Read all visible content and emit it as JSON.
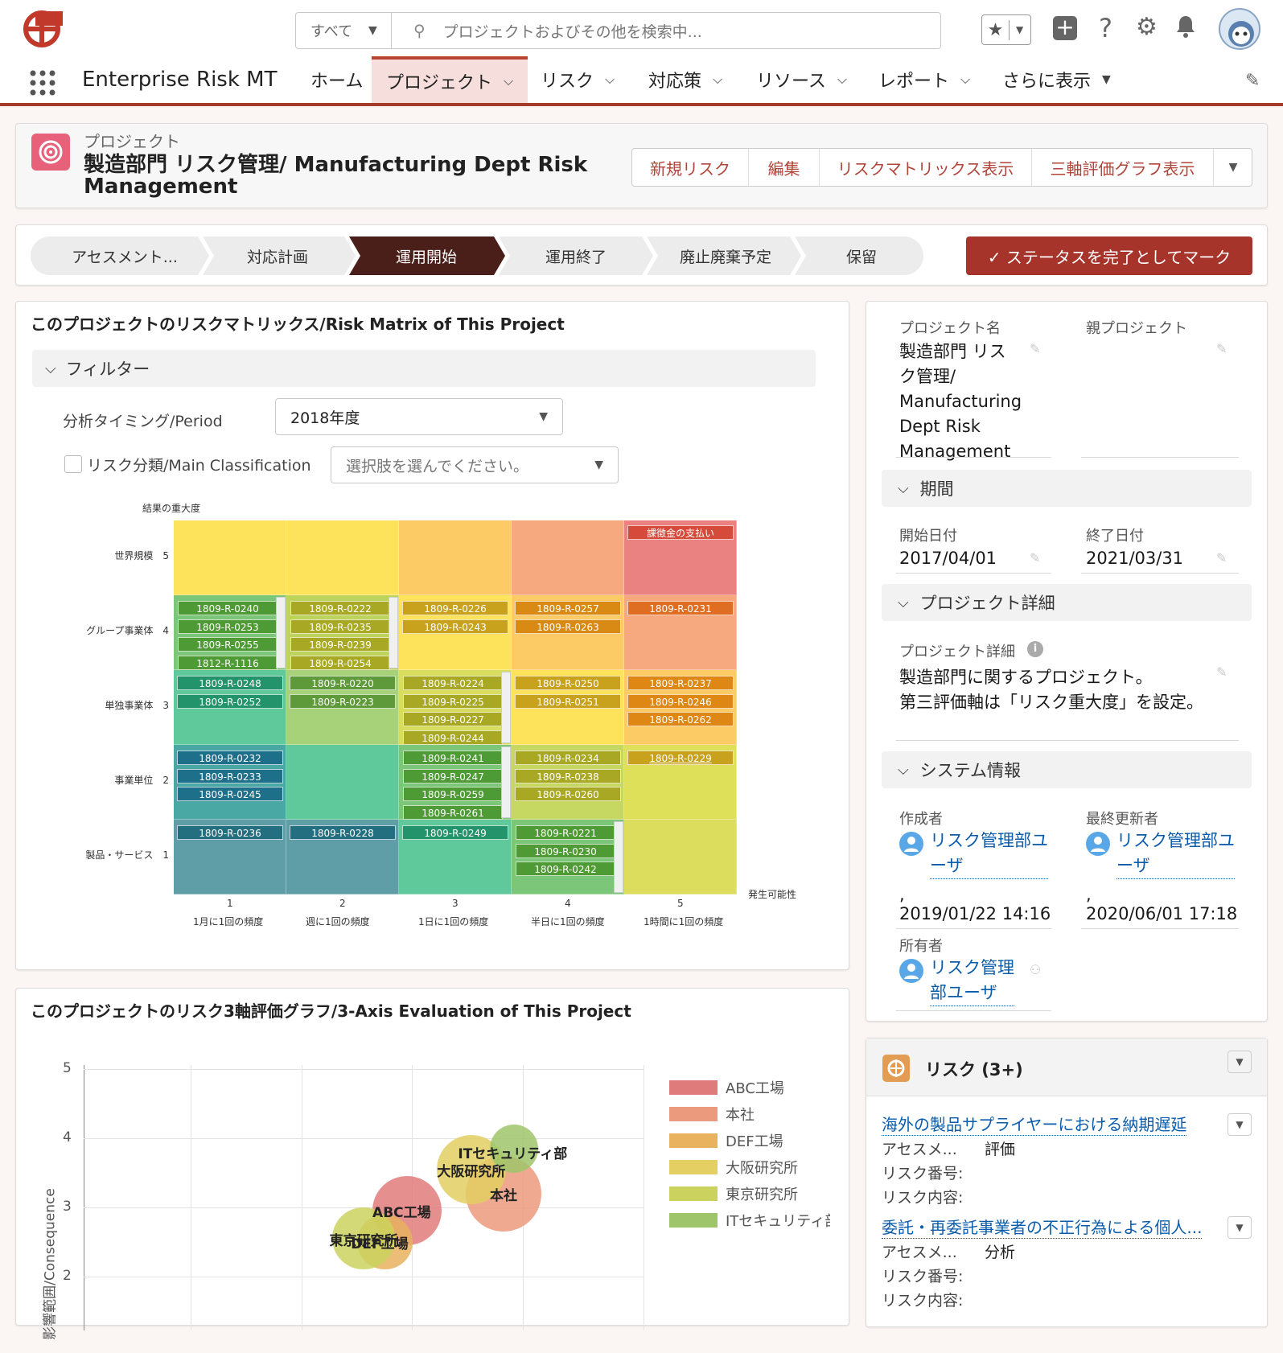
{
  "top": {
    "scope": "すべて",
    "search_placeholder": "プロジェクトおよびその他を検索中...",
    "icons": [
      "favorites-star-icon",
      "add-icon",
      "help-icon",
      "setup-gear-icon",
      "notification-bell-icon",
      "user-avatar"
    ]
  },
  "nav": {
    "app_name": "Enterprise Risk MT",
    "items": [
      "ホーム",
      "プロジェクト",
      "リスク",
      "対応策",
      "リソース",
      "レポート",
      "さらに表示"
    ]
  },
  "header": {
    "object_label": "プロジェクト",
    "title_line1": "製造部門 リスク管理/ Manufacturing Dept Risk",
    "title_line2": "Management",
    "actions": [
      "新規リスク",
      "編集",
      "リスクマトリックス表示",
      "三軸評価グラフ表示"
    ]
  },
  "path": {
    "steps": [
      "アセスメント...",
      "対応計画",
      "運用開始",
      "運用終了",
      "廃止廃棄予定",
      "保留"
    ],
    "current": "運用開始",
    "complete_button": "✓ ステータスを完了としてマーク"
  },
  "matrix": {
    "title": "このプロジェクトのリスクマトリックス/Risk Matrix of This Project",
    "filter_label": "フィルター",
    "period_label": "分析タイミング/Period",
    "period_value": "2018年度",
    "class_label": "リスク分類/Main Classification",
    "class_placeholder": "選択肢を選んでください。",
    "y_axis_title": "結果の重大度",
    "x_axis_title": "発生可能性",
    "rows": [
      "世界規模　5",
      "グループ事業体　4",
      "単独事業体　3",
      "事業単位　2",
      "製品・サービス　1"
    ],
    "cols": [
      {
        "num": "1",
        "label": "1月に1回の頻度"
      },
      {
        "num": "2",
        "label": "週に1回の頻度"
      },
      {
        "num": "3",
        "label": "1日に1回の頻度"
      },
      {
        "num": "4",
        "label": "半日に1回の頻度"
      },
      {
        "num": "5",
        "label": "1時間に1回の頻度"
      }
    ],
    "cells": {
      "r5c5": [
        "課徴金の支払い"
      ],
      "r4c1": [
        "1809-R-0240",
        "1809-R-0253",
        "1809-R-0255",
        "1812-R-1116"
      ],
      "r4c2": [
        "1809-R-0222",
        "1809-R-0235",
        "1809-R-0239",
        "1809-R-0254"
      ],
      "r4c3": [
        "1809-R-0226",
        "1809-R-0243"
      ],
      "r4c4": [
        "1809-R-0257",
        "1809-R-0263"
      ],
      "r4c5": [
        "1809-R-0231"
      ],
      "r3c1": [
        "1809-R-0248",
        "1809-R-0252"
      ],
      "r3c2": [
        "1809-R-0220",
        "1809-R-0223"
      ],
      "r3c3": [
        "1809-R-0224",
        "1809-R-0225",
        "1809-R-0227",
        "1809-R-0244"
      ],
      "r3c4": [
        "1809-R-0250",
        "1809-R-0251"
      ],
      "r3c5": [
        "1809-R-0237",
        "1809-R-0246",
        "1809-R-0262"
      ],
      "r2c1": [
        "1809-R-0232",
        "1809-R-0233",
        "1809-R-0245"
      ],
      "r2c3": [
        "1809-R-0241",
        "1809-R-0247",
        "1809-R-0259",
        "1809-R-0261"
      ],
      "r2c4": [
        "1809-R-0234",
        "1809-R-0238",
        "1809-R-0260"
      ],
      "r2c5": [
        "1809-R-0229"
      ],
      "r1c1": [
        "1809-R-0236"
      ],
      "r1c2": [
        "1809-R-0228"
      ],
      "r1c3": [
        "1809-R-0249"
      ],
      "r1c4": [
        "1809-R-0221",
        "1809-R-0230",
        "1809-R-0242"
      ]
    }
  },
  "bubble": {
    "title": "このプロジェクトのリスク3軸評価グラフ/3-Axis Evaluation of This Project",
    "legend": [
      {
        "name": "ABC工場",
        "color": "#e07b7b"
      },
      {
        "name": "本社",
        "color": "#ec9a7e"
      },
      {
        "name": "DEF工場",
        "color": "#e8b25e"
      },
      {
        "name": "大阪研究所",
        "color": "#e3cf62"
      },
      {
        "name": "東京研究所",
        "color": "#cbd25e"
      },
      {
        "name": "ITセキュリティ部",
        "color": "#9fc56a"
      }
    ]
  },
  "chart_data": {
    "type": "scatter",
    "title": "このプロジェクトのリスク3軸評価グラフ/3-Axis Evaluation of This Project",
    "ylabel": "影響範囲/Consequence",
    "yticks": [
      "5",
      "4",
      "3",
      "2"
    ],
    "ylim": [
      2,
      5
    ],
    "series": [
      {
        "name": "ABC工場",
        "points": [
          {
            "x": 3.0,
            "y": 2.95,
            "r": 0.5
          }
        ]
      },
      {
        "name": "本社",
        "points": [
          {
            "x": 3.9,
            "y": 3.2,
            "r": 0.55
          }
        ]
      },
      {
        "name": "DEF工場",
        "points": [
          {
            "x": 2.8,
            "y": 2.5,
            "r": 0.4
          }
        ]
      },
      {
        "name": "大阪研究所",
        "points": [
          {
            "x": 3.6,
            "y": 3.55,
            "r": 0.5
          }
        ]
      },
      {
        "name": "東京研究所",
        "points": [
          {
            "x": 2.6,
            "y": 2.55,
            "r": 0.45
          }
        ]
      },
      {
        "name": "ITセキュリティ部",
        "points": [
          {
            "x": 4.0,
            "y": 3.85,
            "r": 0.35
          }
        ]
      }
    ],
    "legend_position": "right"
  },
  "details": {
    "project_name_label": "プロジェクト名",
    "project_name_lines": [
      "製造部門 リス",
      "ク管理/",
      "Manufacturing",
      "Dept Risk",
      "Management"
    ],
    "parent_label": "親プロジェクト",
    "period_section": "期間",
    "start_label": "開始日付",
    "start_value": "2017/04/01",
    "end_label": "終了日付",
    "end_value": "2021/03/31",
    "detail_section": "プロジェクト詳細",
    "detail_label": "プロジェクト詳細",
    "detail_line1": "製造部門に関するプロジェクト。",
    "detail_line2": "第三評価軸は「リスク重大度」を設定。",
    "system_section": "システム情報",
    "created_label": "作成者",
    "created_user1": "リスク管理部ユ",
    "created_user2": "ーザ",
    "created_date": "2019/01/22 14:16",
    "modified_label": "最終更新者",
    "modified_user1": "リスク管理部ユ",
    "modified_user2": "ーザ",
    "modified_date": "2020/06/01 17:18",
    "owner_label": "所有者",
    "owner_user1": "リスク管理",
    "owner_user2": "部ユーザ",
    "comma": ","
  },
  "related": {
    "title": "リスク (3+)",
    "items": [
      {
        "link": "海外の製品サプライヤーにおける納期遅延",
        "f1_label": "アセスメ...",
        "f1_value": "評価",
        "f2_label": "リスク番号:",
        "f3_label": "リスク内容:"
      },
      {
        "link": "委託・再委託事業者の不正行為による個人...",
        "f1_label": "アセスメ...",
        "f1_value": "分析",
        "f2_label": "リスク番号:",
        "f3_label": "リスク内容:"
      }
    ]
  }
}
